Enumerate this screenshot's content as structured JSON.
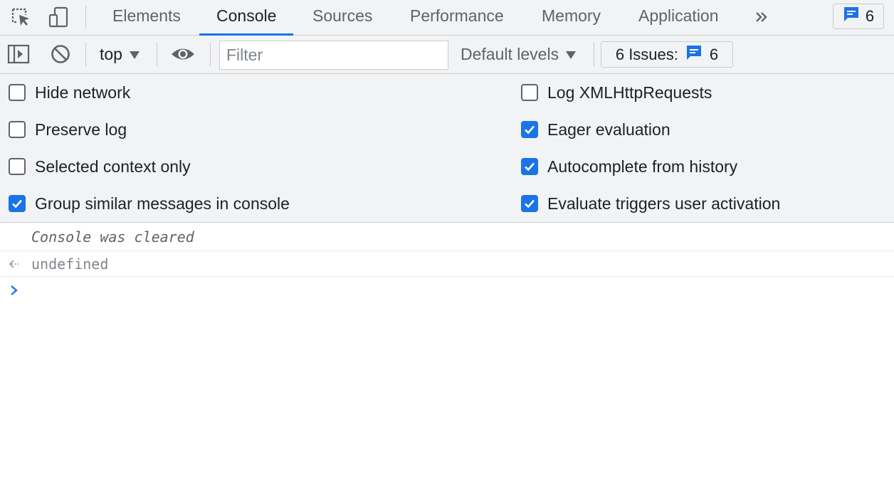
{
  "colors": {
    "accent": "#1a73e8",
    "toolbar_bg": "#f1f3f4",
    "border": "#cacdd1",
    "icon_gray": "#5f6368"
  },
  "tabbar": {
    "icons": [
      "inspect-element-icon",
      "device-toolbar-icon"
    ],
    "tabs": [
      {
        "label": "Elements",
        "active": false
      },
      {
        "label": "Console",
        "active": true
      },
      {
        "label": "Sources",
        "active": false
      },
      {
        "label": "Performance",
        "active": false
      },
      {
        "label": "Memory",
        "active": false
      },
      {
        "label": "Application",
        "active": false
      }
    ],
    "more_tabs_icon": "chevron-double-right-icon",
    "message_badge": {
      "icon": "message-icon",
      "count": "6"
    }
  },
  "toolbar": {
    "sidebar_icon": "show-sidebar-icon",
    "clear_icon": "clear-console-icon",
    "context": "top",
    "live_expression_icon": "eye-icon",
    "filter_placeholder": "Filter",
    "filter_value": "",
    "levels_label": "Default levels",
    "issues_label": "6 Issues:",
    "issues_count": "6"
  },
  "settings": {
    "left": [
      {
        "label": "Hide network",
        "checked": false
      },
      {
        "label": "Preserve log",
        "checked": false
      },
      {
        "label": "Selected context only",
        "checked": false
      },
      {
        "label": "Group similar messages in console",
        "checked": true
      }
    ],
    "right": [
      {
        "label": "Log XMLHttpRequests",
        "checked": false
      },
      {
        "label": "Eager evaluation",
        "checked": true
      },
      {
        "label": "Autocomplete from history",
        "checked": true
      },
      {
        "label": "Evaluate triggers user activation",
        "checked": true
      }
    ]
  },
  "console": {
    "messages": [
      {
        "text": "Console was cleared",
        "kind": "info"
      },
      {
        "text": "undefined",
        "kind": "result",
        "icon": "result-arrow-icon"
      }
    ],
    "prompt_icon": "prompt-chevron-icon",
    "prompt_value": ""
  }
}
